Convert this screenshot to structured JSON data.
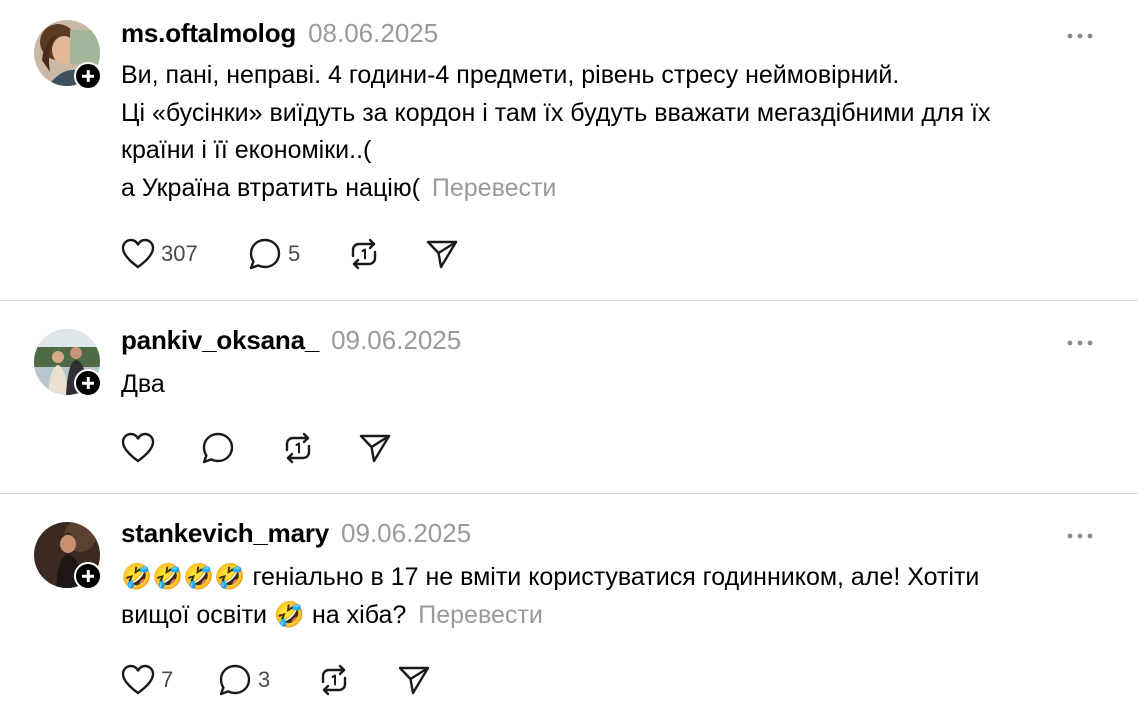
{
  "posts": [
    {
      "username": "ms.oftalmolog",
      "date": "08.06.2025",
      "lines": [
        "Ви, пані, неправі. 4 години-4 предмети, рівень стресу неймовірний.",
        "Ці «бусінки» виїдуть за кордон і там їх будуть вважати мегаздібними для їх",
        "країни і її економіки..(",
        "а Україна втратить націю("
      ],
      "translate_label": "Перевести",
      "likes": "307",
      "comments": "5"
    },
    {
      "username": "pankiv_oksana_",
      "date": "09.06.2025",
      "lines": [
        "Два"
      ],
      "translate_label": "",
      "likes": "",
      "comments": ""
    },
    {
      "username": "stankevich_mary",
      "date": "09.06.2025",
      "lines": [
        "🤣🤣🤣🤣 геніально в 17 не вміти користуватися годинником, але! Хотіти",
        "вищої освіти 🤣 на хіба?"
      ],
      "translate_label": "Перевести",
      "likes": "7",
      "comments": "3"
    }
  ],
  "icons": {
    "like": "heart-icon",
    "comment": "speech-bubble-icon",
    "repost": "repost-icon",
    "share": "send-icon",
    "more": "more-horizontal-icon",
    "follow": "plus-icon"
  },
  "colors": {
    "text": "#000000",
    "muted": "#9a9a9a",
    "divider": "#dcdcdc",
    "icon": "#1a1a1a"
  }
}
